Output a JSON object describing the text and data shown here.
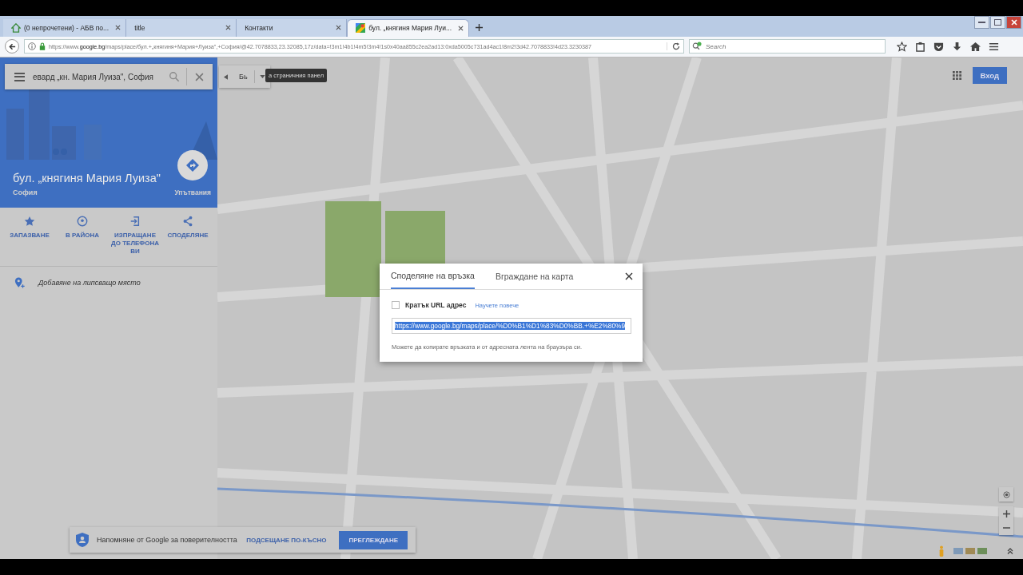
{
  "browser": {
    "tabs": [
      {
        "title": "(0 непрочетени) - АБВ по...",
        "kind": "home",
        "selected": false
      },
      {
        "title": "title",
        "kind": "plain",
        "selected": false
      },
      {
        "title": "Контакти",
        "kind": "plain",
        "selected": false
      },
      {
        "title": "бул. „княгиня Мария Луи...",
        "kind": "maps",
        "selected": true
      }
    ],
    "url": "https://www.**google.bg**/maps/place/бул.+„княгиня+Мария+Луиза\",+София/@42.7078833,23.32085,17z/data=!3m1!4b1!4m5!3m4!1s0x40aa855c2ea2ad13:0xda5005c731ad4ac1!8m2!3d42.7078833!4d23.3230387",
    "search": {
      "placeholder": "Search"
    }
  },
  "maps": {
    "search_box": {
      "value": "евард „кн. Мария Луиза\", София"
    },
    "layer_button": "Бь",
    "tooltip": "а страничния панел",
    "place": {
      "title": "бул. „княгиня Мария Луиза\"",
      "subtitle": "София",
      "directions": "Упътвания"
    },
    "actions": [
      {
        "label": "ЗАПАЗВАНЕ",
        "kind": "save"
      },
      {
        "label": "В РАЙОНА",
        "kind": "nearby"
      },
      {
        "label": "ИЗПРАЩАНЕ ДО ТЕЛЕФОНА ВИ",
        "kind": "send"
      },
      {
        "label": "СПОДЕЛЯНЕ",
        "kind": "share"
      }
    ],
    "add_missing_place": "Добавяне на липсващо място",
    "sign_in": "Вход"
  },
  "dialog": {
    "tabs": [
      {
        "label": "Споделяне на връзка",
        "selected": true
      },
      {
        "label": "Вграждане на карта",
        "selected": false
      }
    ],
    "short_url": {
      "label": "Кратък URL адрес",
      "checked": false
    },
    "learn_more": "Научете повече",
    "link": {
      "value": "https://www.google.bg/maps/place/%D0%B1%D1%83%D0%BB.+%E2%80%9"
    },
    "hint": "Можете да копирате връзката и от адресната лента на браузъра си."
  },
  "privacy_reminder": {
    "text": "Напомняне от Google за поверителността",
    "later": "ПОДСЕЩАНЕ ПО-КЪСНО",
    "review": "ПРЕГЛЕЖДАНЕ"
  }
}
